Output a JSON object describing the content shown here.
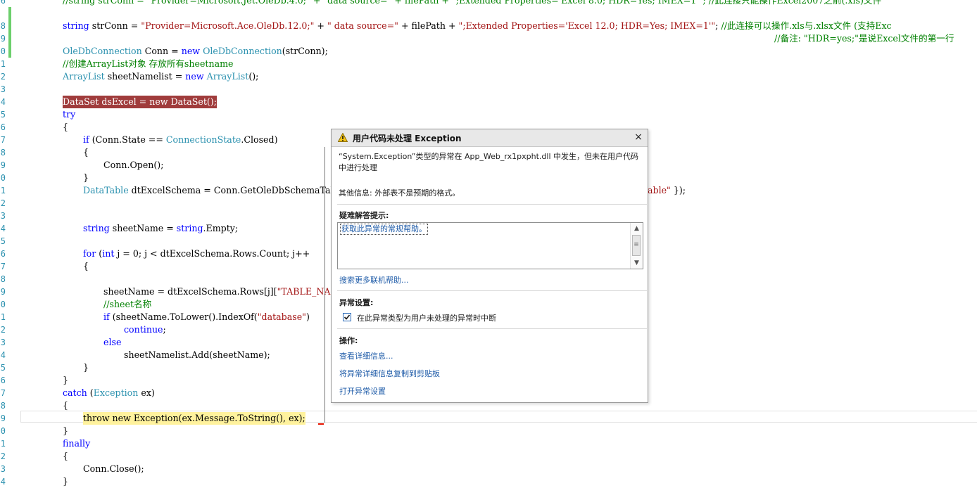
{
  "editor": {
    "lines": [
      {
        "num": "6",
        "segments": [
          {
            "t": "//string strConn = \"Provider=Microsoft.Jet.OleDb.4.0;\" + \"data source=\" + filePath + \";Extended Properties='Excel 8.0; HDR=Yes; IMEX=1'\"; //此连接只能操作Excel2007之前(.xls)文件",
            "c": "cm"
          }
        ]
      },
      {
        "num": "8",
        "segments": [
          {
            "t": "string",
            "c": "kw"
          },
          {
            "t": " strConn = ",
            "c": ""
          },
          {
            "t": "\"Provider=Microsoft.Ace.OleDb.12.0;\"",
            "c": "st"
          },
          {
            "t": " + ",
            "c": ""
          },
          {
            "t": "\" data source=\"",
            "c": "st"
          },
          {
            "t": " + filePath + ",
            "c": ""
          },
          {
            "t": "\";Extended Properties='Excel 12.0; HDR=Yes; IMEX=1'\"",
            "c": "st"
          },
          {
            "t": "; ",
            "c": ""
          },
          {
            "t": "//此连接可以操作.xls与.xlsx文件 (支持Exc",
            "c": "cm"
          }
        ]
      },
      {
        "num": "9",
        "segments": [
          {
            "t": "//备注: \"HDR=yes;\"是说Excel文件的第一行",
            "c": "cm"
          }
        ]
      },
      {
        "num": "0",
        "segments": [
          {
            "t": "OleDbConnection",
            "c": "ty"
          },
          {
            "t": " Conn = ",
            "c": ""
          },
          {
            "t": "new",
            "c": "kw"
          },
          {
            "t": " ",
            "c": ""
          },
          {
            "t": "OleDbConnection",
            "c": "ty"
          },
          {
            "t": "(strConn);",
            "c": ""
          }
        ]
      },
      {
        "num": "1",
        "segments": [
          {
            "t": "//创建ArrayList对象 存放所有sheetname",
            "c": "cm"
          }
        ]
      },
      {
        "num": "2",
        "segments": [
          {
            "t": "ArrayList",
            "c": "ty"
          },
          {
            "t": " sheetNamelist = ",
            "c": ""
          },
          {
            "t": "new",
            "c": "kw"
          },
          {
            "t": " ",
            "c": ""
          },
          {
            "t": "ArrayList",
            "c": "ty"
          },
          {
            "t": "();",
            "c": ""
          }
        ]
      },
      {
        "num": "3",
        "segments": []
      },
      {
        "num": "4",
        "segments": [
          {
            "t": "DataSet dsExcel = new DataSet();",
            "c": ""
          }
        ]
      },
      {
        "num": "5",
        "segments": [
          {
            "t": "try",
            "c": "kw"
          }
        ]
      },
      {
        "num": "6",
        "segments": [
          {
            "t": "{",
            "c": ""
          }
        ]
      },
      {
        "num": "7",
        "segments": [
          {
            "t": "if",
            "c": "kw"
          },
          {
            "t": " (Conn.State == ",
            "c": ""
          },
          {
            "t": "ConnectionState",
            "c": "ty"
          },
          {
            "t": ".Closed)",
            "c": ""
          }
        ]
      },
      {
        "num": "8",
        "segments": [
          {
            "t": "{",
            "c": ""
          }
        ]
      },
      {
        "num": "9",
        "segments": [
          {
            "t": "Conn.Open();",
            "c": ""
          }
        ]
      },
      {
        "num": "0",
        "segments": [
          {
            "t": "}",
            "c": ""
          }
        ]
      },
      {
        "num": "1",
        "segments": [
          {
            "t": "DataTable",
            "c": "ty"
          },
          {
            "t": " dtExcelSchema = Conn.GetOleDbSchemaTab",
            "c": ""
          }
        ]
      },
      {
        "num": "1b",
        "segments": [
          {
            "t": "able\"",
            "c": "st"
          },
          {
            "t": " });",
            "c": ""
          }
        ]
      },
      {
        "num": "2",
        "segments": []
      },
      {
        "num": "3",
        "segments": []
      },
      {
        "num": "4",
        "segments": [
          {
            "t": "string",
            "c": "kw"
          },
          {
            "t": " sheetName = ",
            "c": ""
          },
          {
            "t": "string",
            "c": "kw"
          },
          {
            "t": ".Empty;",
            "c": ""
          }
        ]
      },
      {
        "num": "5",
        "segments": []
      },
      {
        "num": "6",
        "segments": [
          {
            "t": "for",
            "c": "kw"
          },
          {
            "t": " (",
            "c": ""
          },
          {
            "t": "int",
            "c": "kw"
          },
          {
            "t": " j = 0; j < dtExcelSchema.Rows.Count; j++",
            "c": ""
          }
        ]
      },
      {
        "num": "7",
        "segments": [
          {
            "t": "{",
            "c": ""
          }
        ]
      },
      {
        "num": "8",
        "segments": []
      },
      {
        "num": "9",
        "segments": [
          {
            "t": "sheetName = dtExcelSchema.Rows[j][",
            "c": ""
          },
          {
            "t": "\"TABLE_NAM",
            "c": "st"
          }
        ]
      },
      {
        "num": "0",
        "segments": [
          {
            "t": "//sheet名称",
            "c": "cm"
          }
        ]
      },
      {
        "num": "1",
        "segments": [
          {
            "t": "if",
            "c": "kw"
          },
          {
            "t": " (sheetName.ToLower().IndexOf(",
            "c": ""
          },
          {
            "t": "\"database\"",
            "c": "st"
          },
          {
            "t": ")",
            "c": ""
          }
        ]
      },
      {
        "num": "2",
        "segments": [
          {
            "t": "continue",
            "c": "kw"
          },
          {
            "t": ";",
            "c": ""
          }
        ]
      },
      {
        "num": "3",
        "segments": [
          {
            "t": "else",
            "c": "kw"
          }
        ]
      },
      {
        "num": "4",
        "segments": [
          {
            "t": "sheetNamelist.Add(sheetName);",
            "c": ""
          }
        ]
      },
      {
        "num": "5",
        "segments": [
          {
            "t": "}",
            "c": ""
          }
        ]
      },
      {
        "num": "6",
        "segments": [
          {
            "t": "}",
            "c": ""
          }
        ]
      },
      {
        "num": "7",
        "segments": [
          {
            "t": "catch",
            "c": "kw"
          },
          {
            "t": " (",
            "c": ""
          },
          {
            "t": "Exception",
            "c": "ty"
          },
          {
            "t": " ex)",
            "c": ""
          }
        ]
      },
      {
        "num": "8",
        "segments": [
          {
            "t": "{",
            "c": ""
          }
        ]
      },
      {
        "num": "9",
        "segments": [
          {
            "t": "throw new Exception(ex.Message.ToString(), ex);",
            "c": ""
          }
        ]
      },
      {
        "num": "0",
        "segments": [
          {
            "t": "}",
            "c": ""
          }
        ]
      },
      {
        "num": "1",
        "segments": [
          {
            "t": "finally",
            "c": "kw"
          }
        ]
      },
      {
        "num": "2",
        "segments": [
          {
            "t": "{",
            "c": ""
          }
        ]
      },
      {
        "num": "3",
        "segments": [
          {
            "t": "Conn.Close();",
            "c": ""
          }
        ]
      },
      {
        "num": "4",
        "segments": [
          {
            "t": "}",
            "c": ""
          }
        ]
      }
    ]
  },
  "exception_dialog": {
    "title": "用户代码未处理 Exception",
    "close_glyph": "×",
    "message": "“System.Exception”类型的异常在 App_Web_rx1pxpht.dll 中发生，但未在用户代码中进行处理",
    "extra_info": "其他信息: 外部表不是预期的格式。",
    "troubleshooting": {
      "title": "疑难解答提示:",
      "tip_link": "获取此异常的常规帮助。",
      "search_link": "搜索更多联机帮助..."
    },
    "exception_settings": {
      "title": "异常设置:",
      "checkbox_label": "在此异常类型为用户未处理的异常时中断",
      "checked": true
    },
    "actions": {
      "title": "操作:",
      "items": [
        "查看详细信息...",
        "将异常详细信息复制到剪贴板",
        "打开异常设置"
      ]
    }
  }
}
